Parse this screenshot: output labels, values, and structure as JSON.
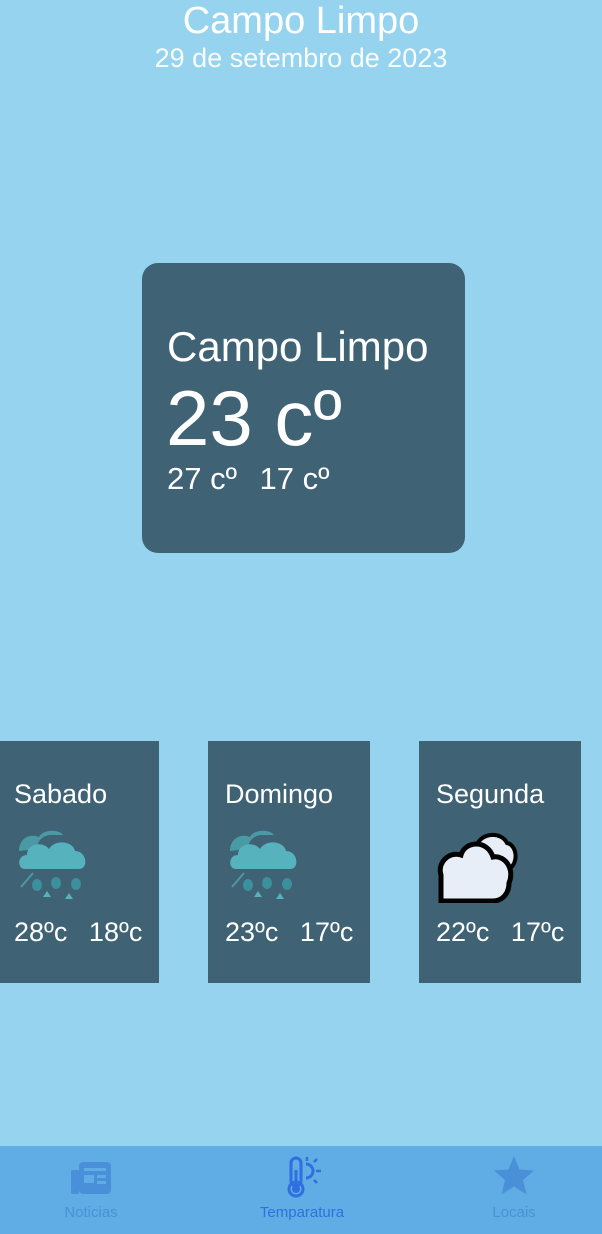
{
  "header": {
    "city": "Campo Limpo",
    "date": "29 de setembro de 2023"
  },
  "current": {
    "city": "Campo Limpo",
    "temp": "23 cº",
    "max": "27 cº",
    "min": "17 cº"
  },
  "forecast": [
    {
      "day": "Sabado",
      "max": "28ºc",
      "min": "18ºc",
      "icon": "rain-cloud-icon"
    },
    {
      "day": "Domingo",
      "max": "23ºc",
      "min": "17ºc",
      "icon": "rain-cloud-icon"
    },
    {
      "day": "Segunda",
      "max": "22ºc",
      "min": "17ºc",
      "icon": "cloudy-icon"
    }
  ],
  "tabs": [
    {
      "label": "Noticias",
      "icon": "newspaper-icon",
      "active": false
    },
    {
      "label": "Temparatura",
      "icon": "thermometer-sun-icon",
      "active": true
    },
    {
      "label": "Locais",
      "icon": "star-icon",
      "active": false
    }
  ],
  "colors": {
    "background": "#96d3ee",
    "card": "#3f6275",
    "tabbar": "#5fade4",
    "tab_inactive": "#4a90d9",
    "tab_active": "#2f6fe0"
  }
}
